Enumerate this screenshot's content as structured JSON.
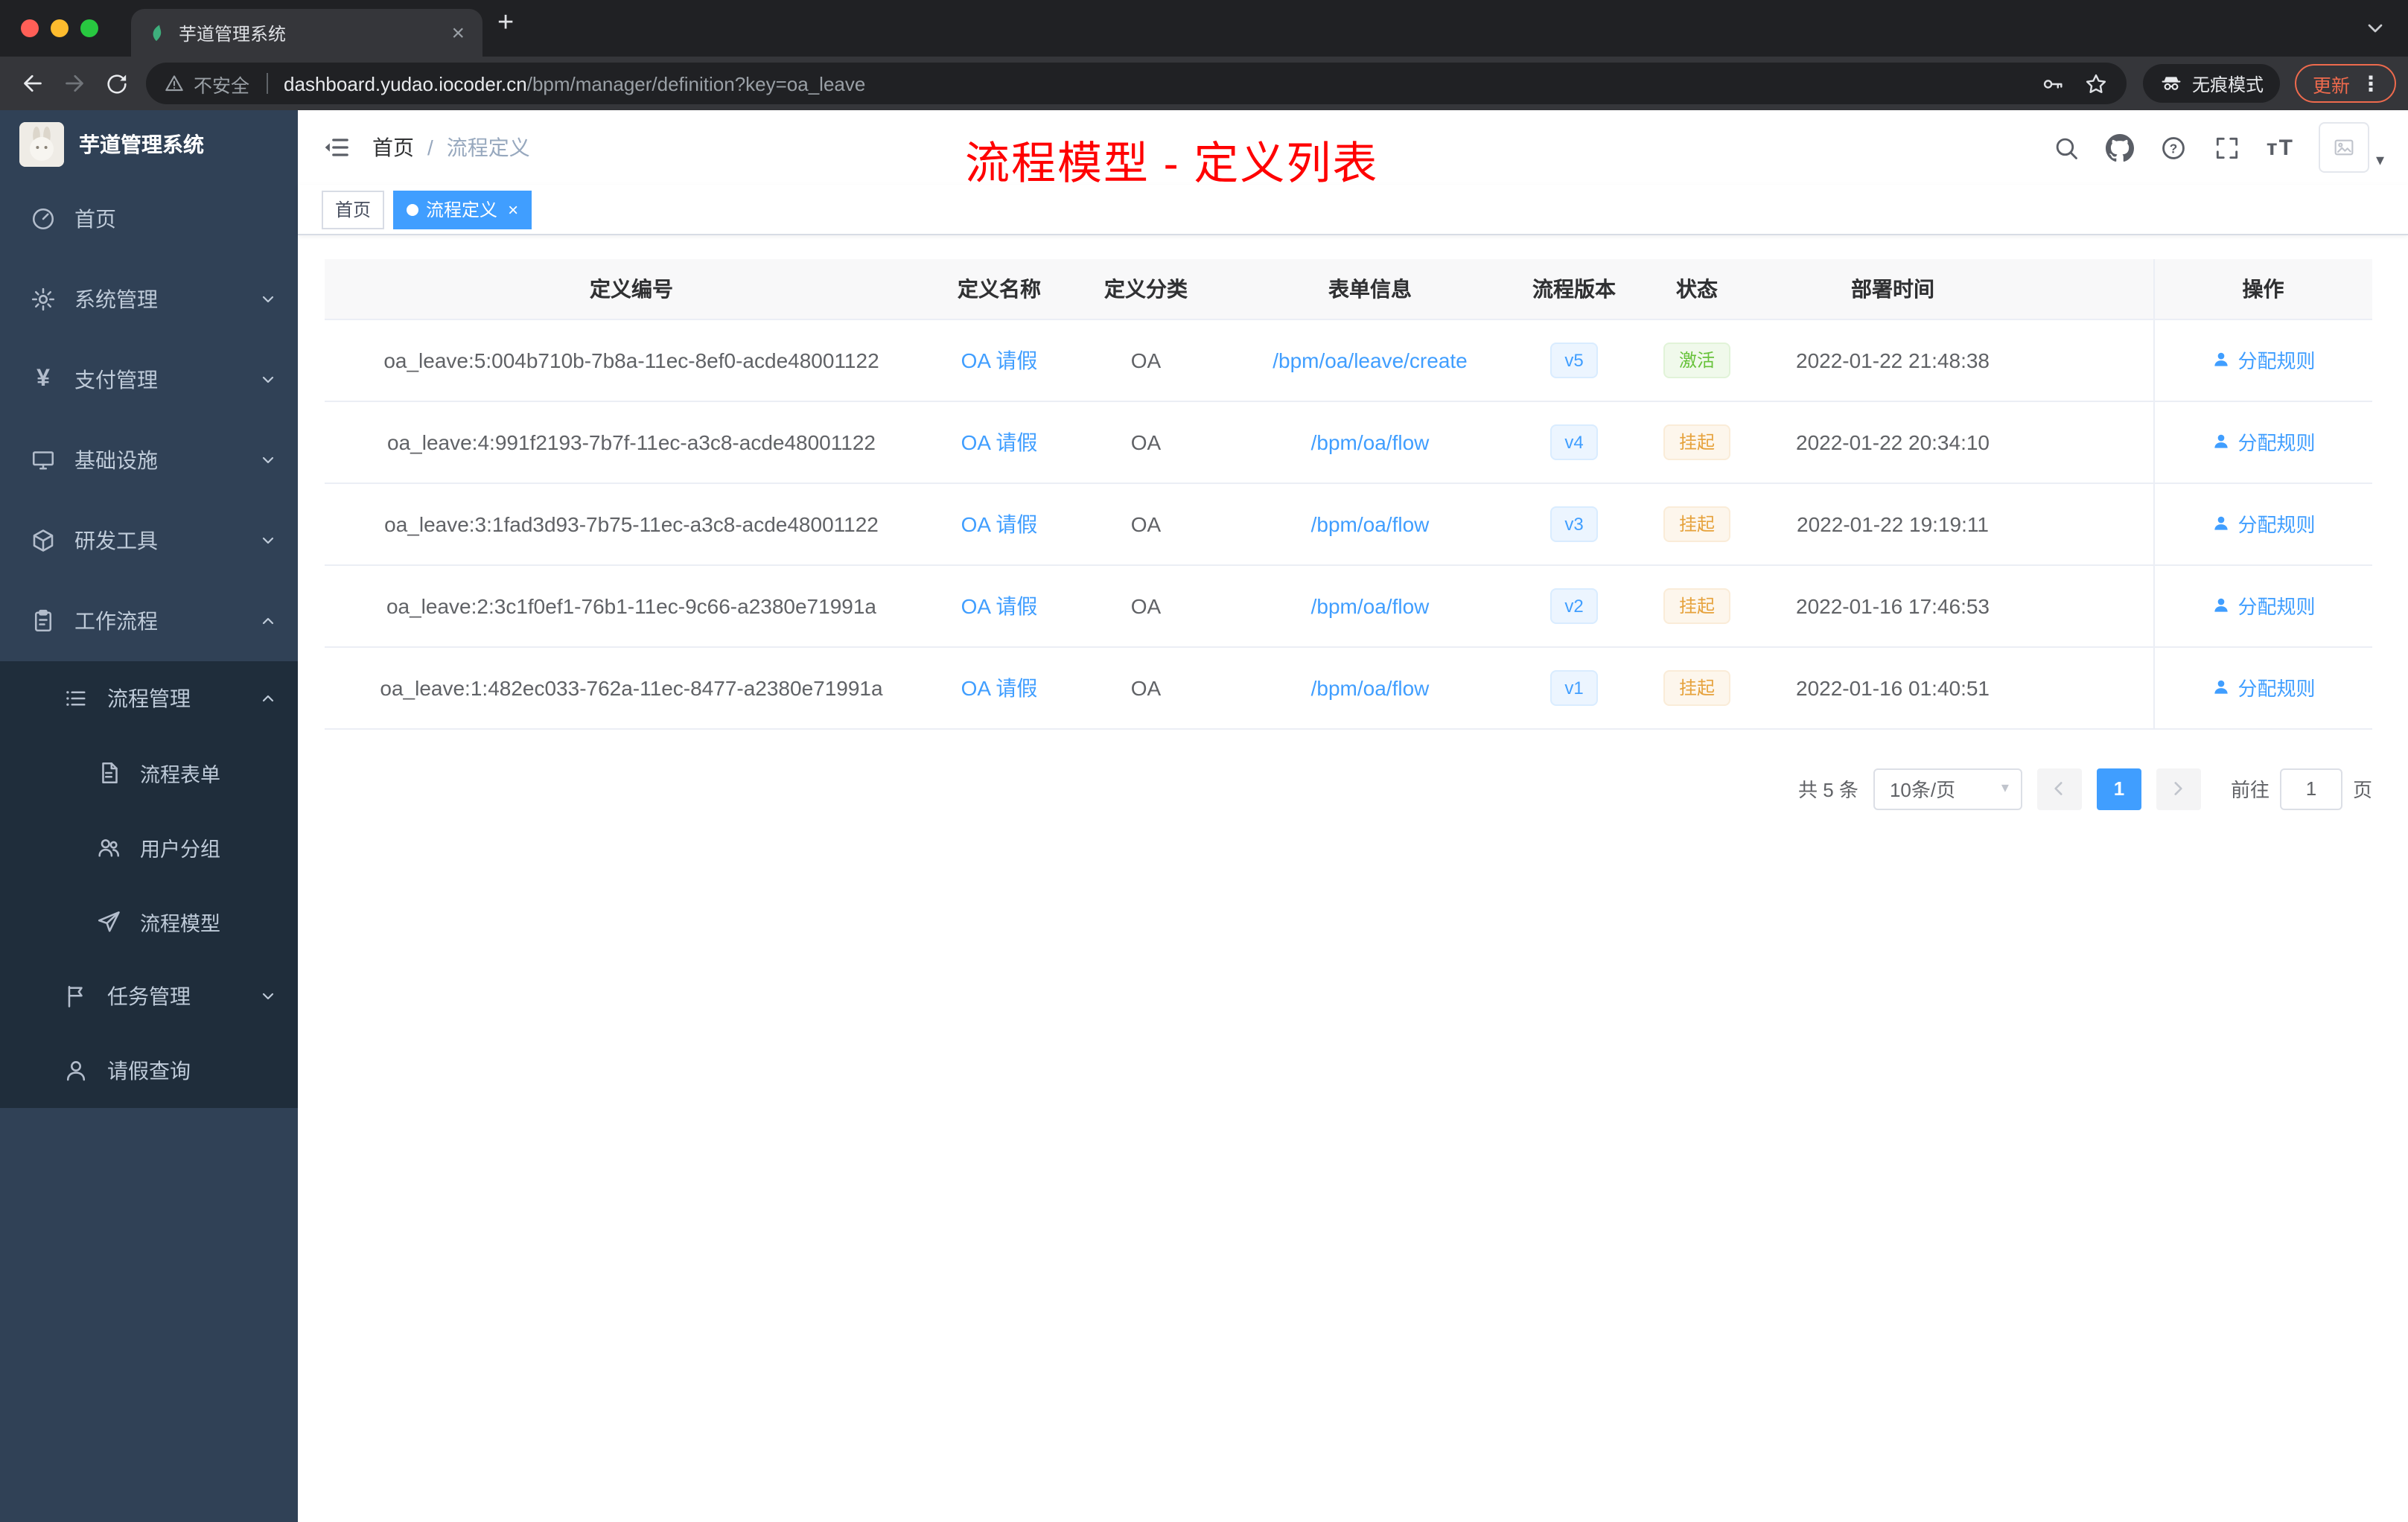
{
  "browser": {
    "tab_title": "芋道管理系统",
    "security_label": "不安全",
    "url_domain": "dashboard.yudao.iocoder.cn",
    "url_path": "/bpm/manager/definition?key=oa_leave",
    "incognito_label": "无痕模式",
    "update_label": "更新"
  },
  "sidebar": {
    "logo_title": "芋道管理系统",
    "items": [
      {
        "label": "首页"
      },
      {
        "label": "系统管理"
      },
      {
        "label": "支付管理"
      },
      {
        "label": "基础设施"
      },
      {
        "label": "研发工具"
      },
      {
        "label": "工作流程"
      },
      {
        "label": "流程管理"
      },
      {
        "label": "流程表单"
      },
      {
        "label": "用户分组"
      },
      {
        "label": "流程模型"
      },
      {
        "label": "任务管理"
      },
      {
        "label": "请假查询"
      }
    ]
  },
  "header": {
    "breadcrumb": {
      "home": "首页",
      "separator": "/",
      "current": "流程定义"
    },
    "annotation": "流程模型 - 定义列表"
  },
  "tags": {
    "first": "首页",
    "active": "流程定义"
  },
  "table": {
    "columns": [
      "定义编号",
      "定义名称",
      "定义分类",
      "表单信息",
      "流程版本",
      "状态",
      "部署时间",
      "操作"
    ],
    "rows": [
      {
        "id": "oa_leave:5:004b710b-7b8a-11ec-8ef0-acde48001122",
        "name": "OA 请假",
        "category": "OA",
        "form": "/bpm/oa/leave/create",
        "version": "v5",
        "status": "激活",
        "time": "2022-01-22 21:48:38",
        "action": "分配规则"
      },
      {
        "id": "oa_leave:4:991f2193-7b7f-11ec-a3c8-acde48001122",
        "name": "OA 请假",
        "category": "OA",
        "form": "/bpm/oa/flow",
        "version": "v4",
        "status": "挂起",
        "time": "2022-01-22 20:34:10",
        "action": "分配规则"
      },
      {
        "id": "oa_leave:3:1fad3d93-7b75-11ec-a3c8-acde48001122",
        "name": "OA 请假",
        "category": "OA",
        "form": "/bpm/oa/flow",
        "version": "v3",
        "status": "挂起",
        "time": "2022-01-22 19:19:11",
        "action": "分配规则"
      },
      {
        "id": "oa_leave:2:3c1f0ef1-76b1-11ec-9c66-a2380e71991a",
        "name": "OA 请假",
        "category": "OA",
        "form": "/bpm/oa/flow",
        "version": "v2",
        "status": "挂起",
        "time": "2022-01-16 17:46:53",
        "action": "分配规则"
      },
      {
        "id": "oa_leave:1:482ec033-762a-11ec-8477-a2380e71991a",
        "name": "OA 请假",
        "category": "OA",
        "form": "/bpm/oa/flow",
        "version": "v1",
        "status": "挂起",
        "time": "2022-01-16 01:40:51",
        "action": "分配规则"
      }
    ]
  },
  "pagination": {
    "total": "共 5 条",
    "page_size": "10条/页",
    "current_page": "1",
    "goto_label": "前往",
    "goto_value": "1",
    "page_unit": "页"
  },
  "icons_text": {
    "question_mark": "?",
    "font_size": "тT",
    "dots_vertical": "⋮",
    "close": "×",
    "plus": "+",
    "yen": "¥",
    "caret_down": "▾"
  },
  "colors": {
    "accent": "#409eff",
    "success": "#67c23a",
    "warning": "#e6a23c",
    "annotation_red": "#ff0000",
    "sidebar_bg": "#304156",
    "submenu_bg": "#1f2d3b"
  }
}
